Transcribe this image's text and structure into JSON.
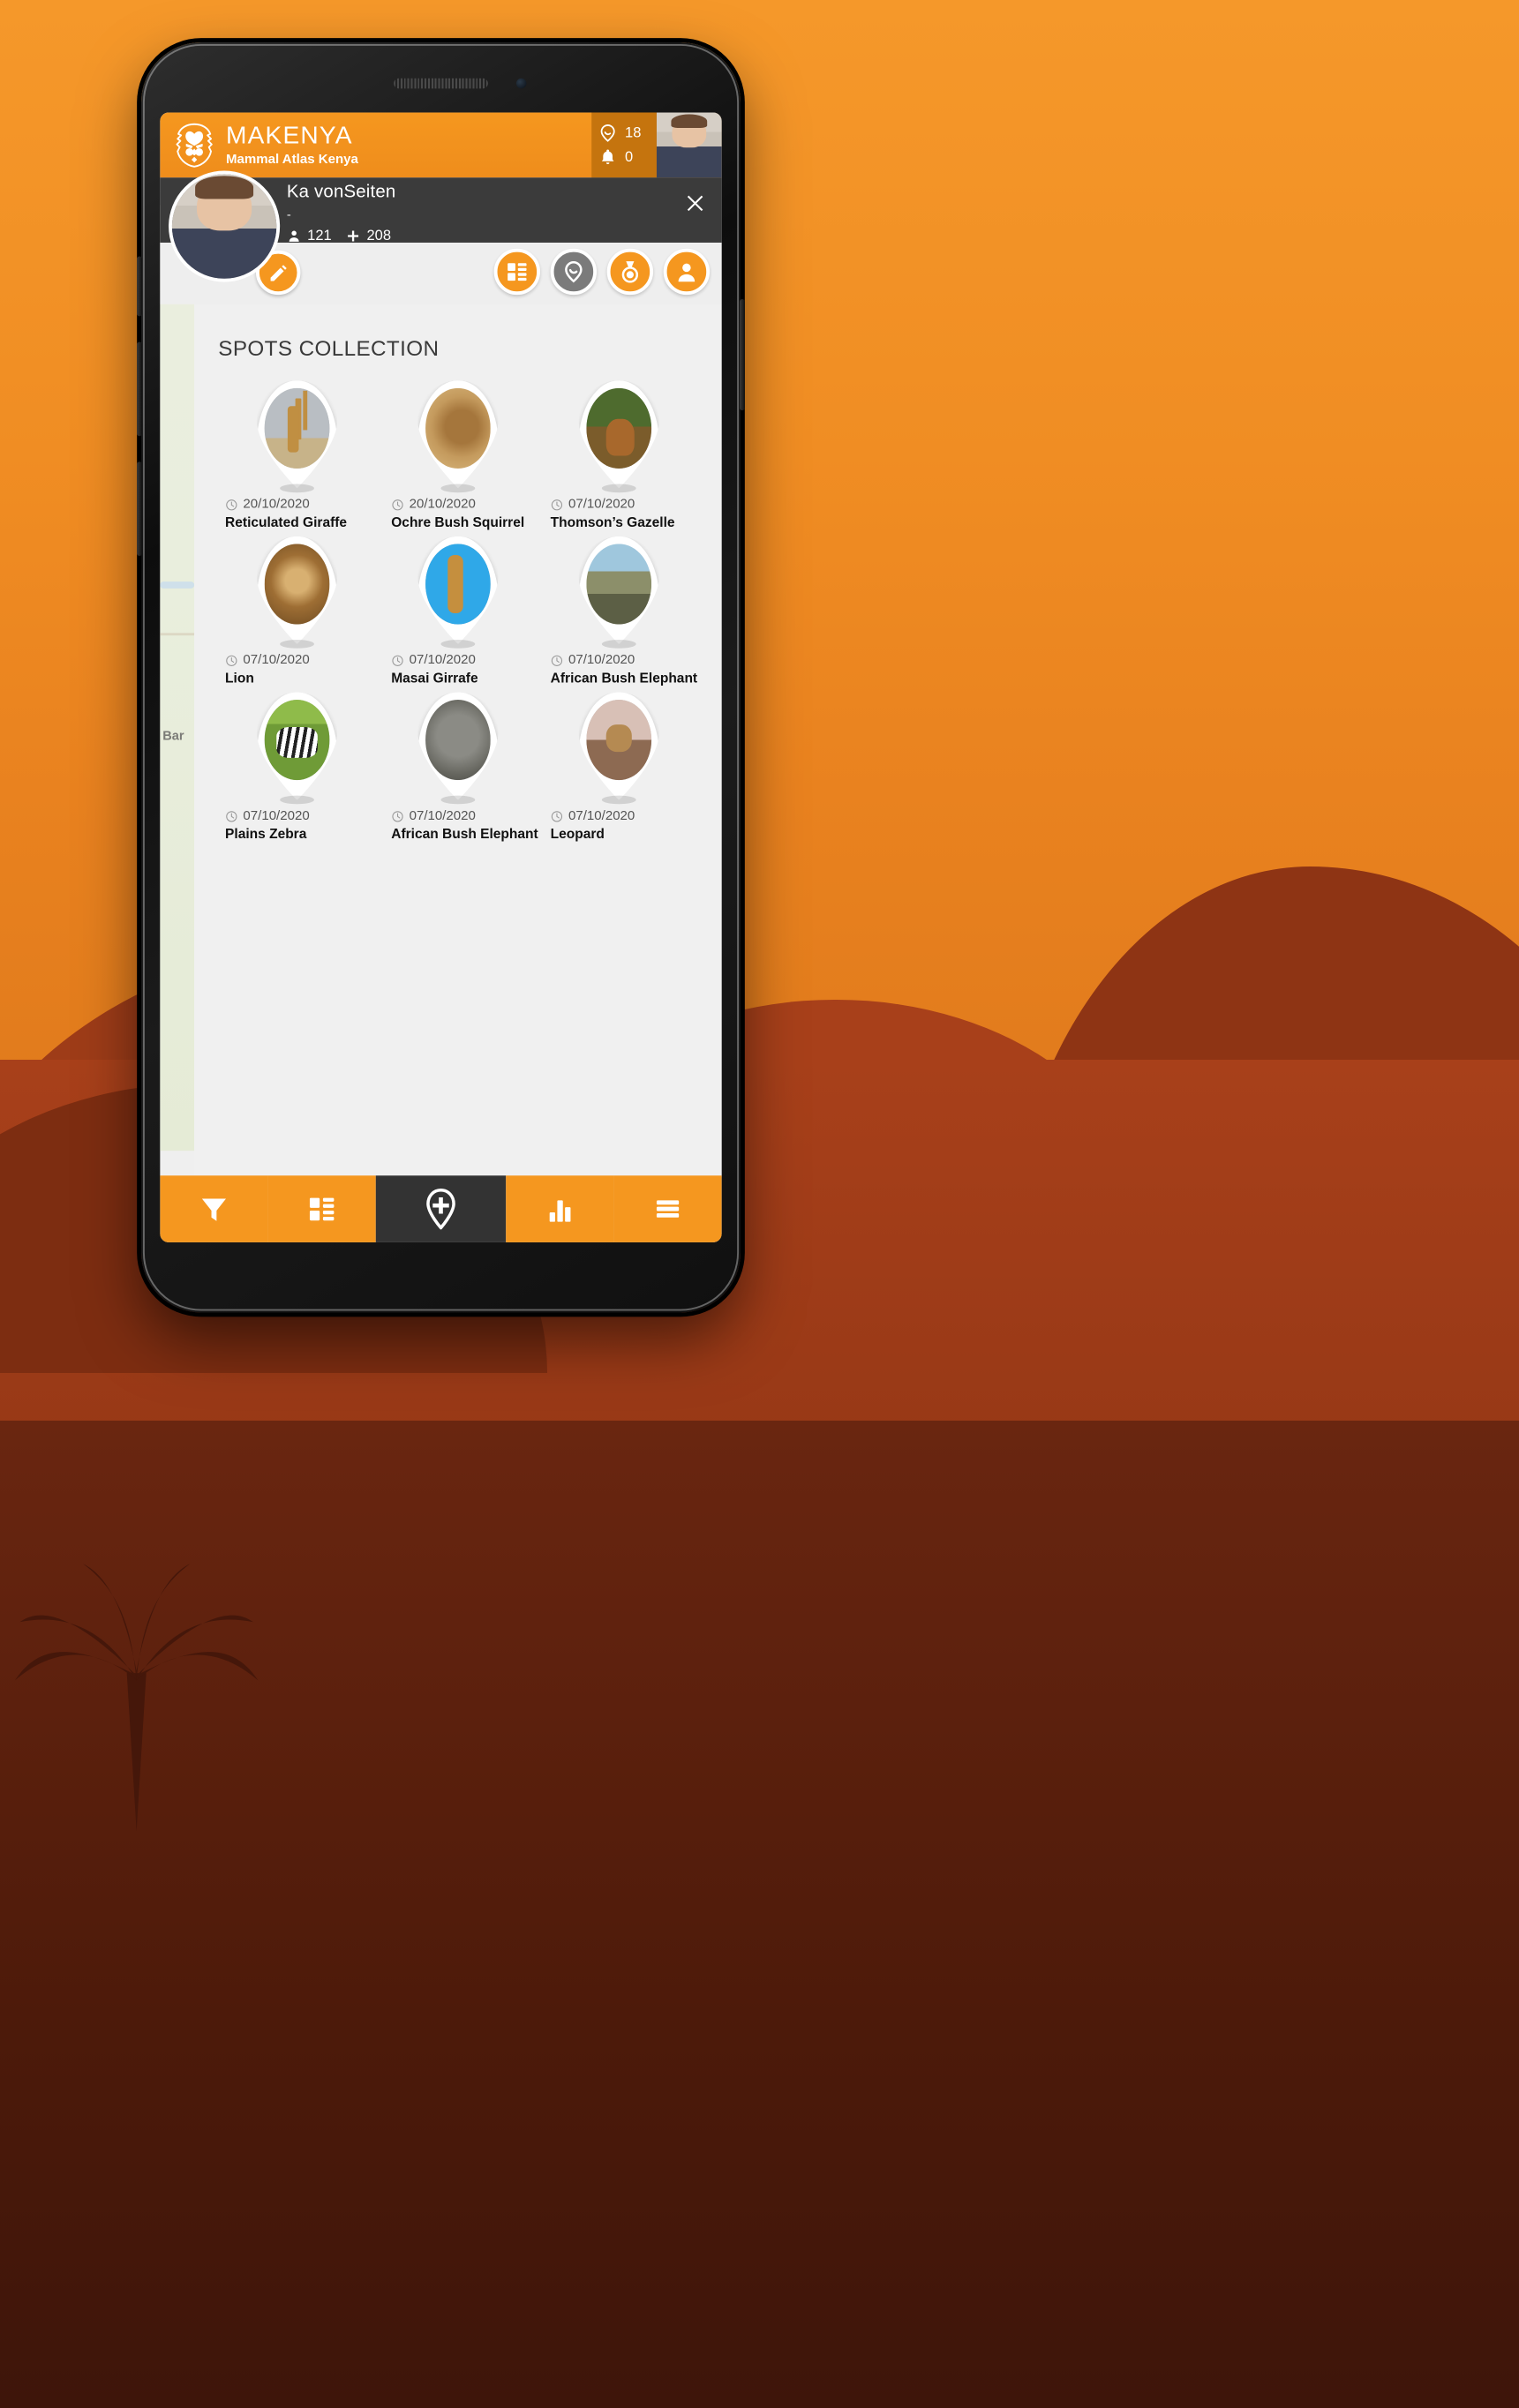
{
  "app": {
    "brand_name": "MAKENYA",
    "brand_tagline": "Mammal Atlas Kenya",
    "logo_icon": "lion-head-icon",
    "accent_color": "#f5971f",
    "counters": [
      {
        "icon": "map-pin-icon",
        "value": "18"
      },
      {
        "icon": "bell-icon",
        "value": "0"
      }
    ]
  },
  "profile": {
    "name": "Ka vonSeiten",
    "subtitle": "-",
    "stats": [
      {
        "icon": "person-icon",
        "value": "121"
      },
      {
        "icon": "plus-icon",
        "value": "208"
      }
    ],
    "close_icon": "close-icon",
    "edit_icon": "pencil-icon",
    "tabs": [
      {
        "name": "tab-spots-grid",
        "icon": "grid-list-icon",
        "active": true
      },
      {
        "name": "tab-map-pins",
        "icon": "map-pin-icon",
        "active": false
      },
      {
        "name": "tab-achievements",
        "icon": "medal-icon",
        "active": true
      },
      {
        "name": "tab-profile",
        "icon": "person-icon",
        "active": true
      }
    ]
  },
  "map": {
    "label": "Bar"
  },
  "section": {
    "title": "SPOTS COLLECTION"
  },
  "spots": [
    {
      "date": "20/10/2020",
      "name": "Reticulated Giraffe",
      "thumb": "giraffe"
    },
    {
      "date": "20/10/2020",
      "name": "Ochre Bush Squirrel",
      "thumb": "squirrel"
    },
    {
      "date": "07/10/2020",
      "name": "Thomson’s Gazelle",
      "thumb": "gazelle"
    },
    {
      "date": "07/10/2020",
      "name": "Lion",
      "thumb": "lion"
    },
    {
      "date": "07/10/2020",
      "name": "Masai Girrafe",
      "thumb": "masai"
    },
    {
      "date": "07/10/2020",
      "name": "African Bush Elephant",
      "thumb": "elephants"
    },
    {
      "date": "07/10/2020",
      "name": "Plains Zebra",
      "thumb": "zebra"
    },
    {
      "date": "07/10/2020",
      "name": "African Bush Elephant",
      "thumb": "elephant2"
    },
    {
      "date": "07/10/2020",
      "name": "Leopard",
      "thumb": "leopard"
    }
  ],
  "bottom_nav": [
    {
      "name": "nav-filter",
      "icon": "funnel-icon"
    },
    {
      "name": "nav-list",
      "icon": "grid-list-icon"
    },
    {
      "name": "nav-add-spot",
      "icon": "add-pin-icon"
    },
    {
      "name": "nav-stats",
      "icon": "bar-chart-icon"
    },
    {
      "name": "nav-menu",
      "icon": "hamburger-icon"
    }
  ]
}
